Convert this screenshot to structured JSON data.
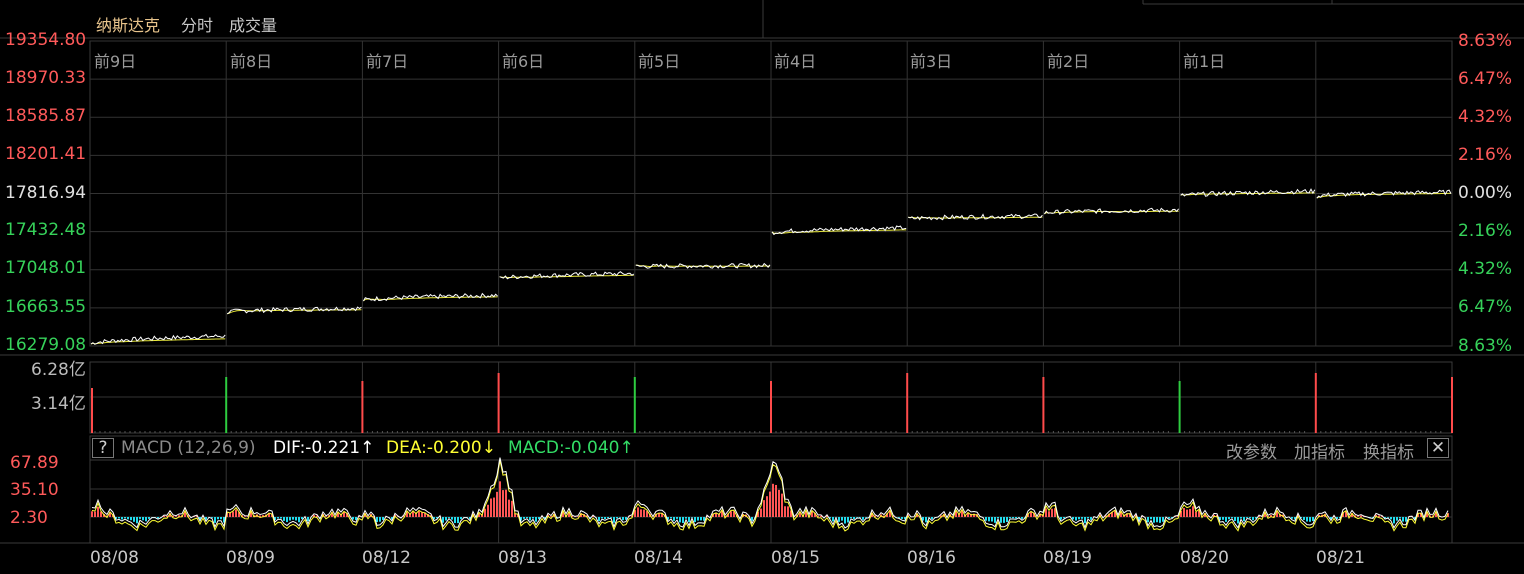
{
  "header": {
    "title": "纳斯达克",
    "tab_fenshi": "分时",
    "tab_volume": "成交量"
  },
  "main_chart": {
    "left_ticks": [
      "19354.80",
      "18970.33",
      "18585.87",
      "18201.41",
      "17816.94",
      "17432.48",
      "17048.01",
      "16663.55",
      "16279.08"
    ],
    "right_ticks": [
      "8.63%",
      "6.47%",
      "4.32%",
      "2.16%",
      "0.00%",
      "2.16%",
      "4.32%",
      "6.47%",
      "8.63%"
    ],
    "day_labels": [
      "前9日",
      "前8日",
      "前7日",
      "前6日",
      "前5日",
      "前4日",
      "前3日",
      "前2日",
      "前1日"
    ]
  },
  "volume_chart": {
    "ticks": [
      "6.28亿",
      "3.14亿"
    ]
  },
  "macd": {
    "help": "?",
    "title": "MACD (12,26,9)",
    "dif": "DIF:-0.221↑",
    "dea": "DEA:-0.200↓",
    "macd": "MACD:-0.040↑",
    "btn_params": "改参数",
    "btn_add": "加指标",
    "btn_switch": "换指标",
    "btn_close": "✕",
    "ticks": [
      "67.89",
      "35.10",
      "2.30"
    ]
  },
  "x_axis": [
    "08/08",
    "08/09",
    "08/12",
    "08/13",
    "08/14",
    "08/15",
    "08/16",
    "08/19",
    "08/20",
    "08/21"
  ],
  "colors": {
    "up": "#ff4b4b",
    "down": "#2ecc40",
    "price_line": "#ffffff",
    "avg_line": "#e8e83c",
    "dif": "#ffffff",
    "dea": "#ffff33",
    "macd_green": "#33dd66",
    "macd_pos": "#ff5555",
    "macd_neg": "#22ddee",
    "grid": "#333333",
    "label_orange": "#e07a50"
  },
  "chart_data": [
    {
      "type": "line",
      "title": "纳斯达克 分时",
      "x": [
        "08/08",
        "08/09",
        "08/12",
        "08/13",
        "08/14",
        "08/15",
        "08/16",
        "08/19",
        "08/20",
        "08/21"
      ],
      "series": [
        {
          "values": [
            16380,
            16660,
            16790,
            17010,
            17090,
            17470,
            17590,
            17650,
            17840,
            17830
          ]
        }
      ],
      "ylim": [
        16279.08,
        19354.8
      ]
    },
    {
      "type": "bar",
      "title": "成交量",
      "ylim": [
        0,
        6.28
      ]
    },
    {
      "type": "line",
      "title": "MACD (12,26,9)",
      "ylim": [
        2.3,
        67.89
      ]
    }
  ]
}
